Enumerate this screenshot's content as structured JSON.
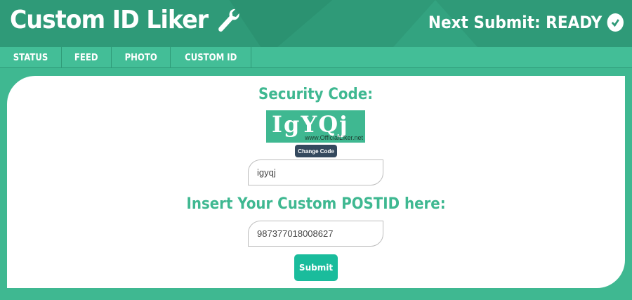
{
  "header": {
    "title": "Custom ID Liker",
    "next_submit": "Next Submit: READY"
  },
  "nav": {
    "items": [
      {
        "label": "STATUS"
      },
      {
        "label": "FEED"
      },
      {
        "label": "PHOTO"
      },
      {
        "label": "CUSTOM ID"
      }
    ]
  },
  "form": {
    "security_title": "Security Code:",
    "captcha_text": "IgYQj",
    "captcha_watermark": "www.OfficialLiker.net",
    "change_code_label": "Change Code",
    "captcha_value": "igyqj",
    "postid_title": "Insert Your Custom POSTID here:",
    "postid_value": "987377018008627",
    "submit_label": "Submit"
  },
  "colors": {
    "accent": "#3fb891",
    "header_bg": "#2f9a78",
    "button": "#1abc9c",
    "change_code_bg": "#34495e"
  }
}
